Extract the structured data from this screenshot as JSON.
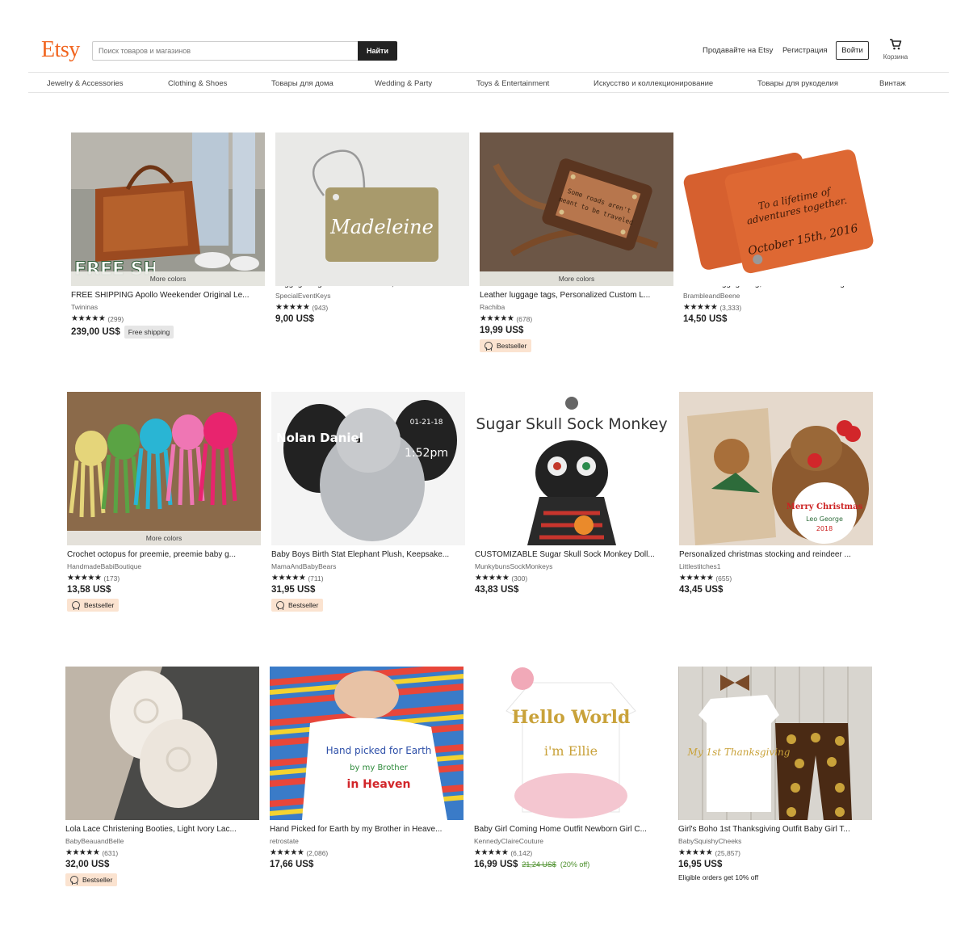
{
  "header": {
    "logo": "Etsy",
    "search_placeholder": "Поиск товаров и магазинов",
    "search_button": "Найти",
    "sell_link": "Продавайте на Etsy",
    "register_link": "Регистрация",
    "signin_button": "Войти",
    "cart_label": "Корзина"
  },
  "nav": [
    "Jewelry & Accessories",
    "Clothing & Shoes",
    "Товары для дома",
    "Wedding & Party",
    "Toys & Entertainment",
    "Искусство и коллекционирование",
    "Товары для рукоделия",
    "Винтаж"
  ],
  "colors": {
    "brand": "#f1641e",
    "bestseller_bg": "#fbe3d0",
    "discount": "#4b8f2a"
  },
  "products": [
    {
      "title": "FREE SHIPPING Apollo Weekender Original Le...",
      "shop": "Twininas",
      "stars": "★★★★★",
      "reviews": "(299)",
      "price": "239,00 US$",
      "more_colors": "More colors",
      "tag": "Free shipping",
      "image_text": "FREE SHIPPING"
    },
    {
      "title": "Luggage Tag - FREE SHIPPING, Gold and Whit...",
      "shop": "SpecialEventKeys",
      "stars": "★★★★★",
      "reviews": "(943)",
      "price": "9,00 US$",
      "image_text": "Madeleine"
    },
    {
      "title": "Leather luggage tags, Personalized Custom L...",
      "shop": "Rachiba",
      "stars": "★★★★★",
      "reviews": "(678)",
      "price": "19,99 US$",
      "more_colors": "More colors",
      "bestseller": "Bestseller"
    },
    {
      "title": "Leather Luggage Tag, Personalized Wedding ...",
      "shop": "BrambleandBeene",
      "stars": "★★★★★",
      "reviews": "(3,333)",
      "price": "14,50 US$",
      "image_text": "To a lifetime of adventures together"
    },
    {
      "title": "Crochet octopus for preemie, preemie baby g...",
      "shop": "HandmadeBabiBoutique",
      "stars": "★★★★★",
      "reviews": "(173)",
      "price": "13,58 US$",
      "more_colors": "More colors",
      "bestseller": "Bestseller"
    },
    {
      "title": "Baby Boys Birth Stat Elephant Plush, Keepsake...",
      "shop": "MamaAndBabyBears",
      "stars": "★★★★★",
      "reviews": "(711)",
      "price": "31,95 US$",
      "bestseller": "Bestseller",
      "image_text": "Nolan Daniel"
    },
    {
      "title": "CUSTOMIZABLE Sugar Skull Sock Monkey Doll...",
      "shop": "MunkybunsSockMonkeys",
      "stars": "★★★★★",
      "reviews": "(300)",
      "price": "43,83 US$",
      "image_text": "Sugar Skull Sock Monkey"
    },
    {
      "title": "Personalized christmas stocking and reindeer ...",
      "shop": "Littlestitches1",
      "stars": "★★★★★",
      "reviews": "(655)",
      "price": "43,45 US$",
      "image_text": "Merry Christmas"
    },
    {
      "title": "Lola Lace Christening Booties, Light Ivory Lac...",
      "shop": "BabyBeauandBelle",
      "stars": "★★★★★",
      "reviews": "(631)",
      "price": "32,00 US$",
      "bestseller": "Bestseller"
    },
    {
      "title": "Hand Picked for Earth by my Brother in Heave...",
      "shop": "retrostate",
      "stars": "★★★★★",
      "reviews": "(2,086)",
      "price": "17,66 US$",
      "image_text": "Hand picked for Earth"
    },
    {
      "title": "Baby Girl Coming Home Outfit Newborn Girl C...",
      "shop": "KennedyClaireCouture",
      "stars": "★★★★★",
      "reviews": "(6,142)",
      "price": "16,99 US$",
      "original_price": "21,24 US$",
      "discount": "(20% off)",
      "image_text": "Hello World"
    },
    {
      "title": "Girl's Boho 1st Thanksgiving Outfit Baby Girl T...",
      "shop": "BabySquishyCheeks",
      "stars": "★★★★★",
      "reviews": "(25,857)",
      "price": "16,95 US$",
      "note": "Eligible orders get 10% off",
      "image_text": "My 1st Thanksgiving"
    }
  ]
}
